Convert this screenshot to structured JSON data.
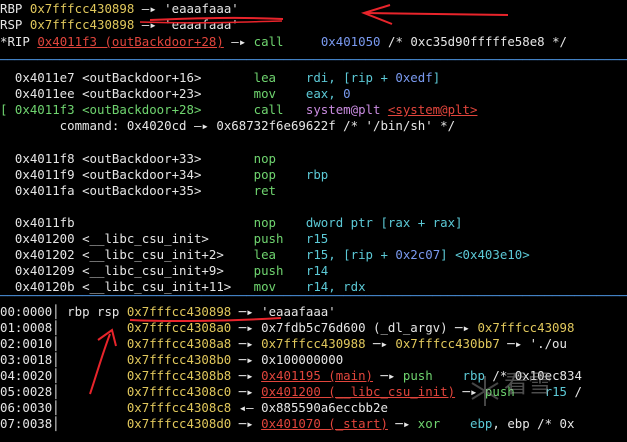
{
  "registers": {
    "rbp": {
      "name": "RBP",
      "addr": "0x7fffcc430898",
      "arrow": "—▸",
      "value": "'eaaafaaa'"
    },
    "rsp": {
      "name": "RSP",
      "addr": "0x7fffcc430898",
      "arrow": "—▸",
      "value": "'eaaafaaa'"
    },
    "rip": {
      "name": "*RIP",
      "addr": "0x4011f3 (outBackdoor+28)",
      "arrow": "—▸",
      "op": "call",
      "arg": "0x401050",
      "comment": "/* 0xc35d90fffffe58e8 */"
    }
  },
  "separator": "──────────────────────────────────────────────────────────────────────────────────────────────",
  "disasm": [
    {
      "addr": "0x4011e7",
      "sym": "<outBackdoor+16>",
      "op": "lea",
      "a": "rdi, [rip + ",
      "b": "0xedf",
      "c": "]"
    },
    {
      "addr": "0x4011ee",
      "sym": "<outBackdoor+23>",
      "op": "mov",
      "a": "eax, ",
      "b": "0",
      "c": ""
    },
    {
      "addr": "0x4011f3",
      "sym": "<outBackdoor+28>",
      "op": "call",
      "a": "system@plt",
      "b": "<system@plt>",
      "c": ""
    },
    {
      "addr": "0x4011f8",
      "sym": "<outBackdoor+33>",
      "op": "nop",
      "a": "",
      "b": "",
      "c": ""
    },
    {
      "addr": "0x4011f9",
      "sym": "<outBackdoor+34>",
      "op": "pop",
      "a": "rbp",
      "b": "",
      "c": ""
    },
    {
      "addr": "0x4011fa",
      "sym": "<outBackdoor+35>",
      "op": "ret",
      "a": "",
      "b": "",
      "c": ""
    },
    {
      "addr": "0x4011fb",
      "sym": "",
      "op": "nop",
      "a": "dword ptr [rax + rax]",
      "b": "",
      "c": ""
    },
    {
      "addr": "0x401200",
      "sym": "<__libc_csu_init>",
      "op": "push",
      "a": "r15",
      "b": "",
      "c": ""
    },
    {
      "addr": "0x401202",
      "sym": "<__libc_csu_init+2>",
      "op": "lea",
      "a": "r15, [rip + ",
      "b": "0x2c07",
      "c": "] <0x403e10>"
    },
    {
      "addr": "0x401209",
      "sym": "<__libc_csu_init+9>",
      "op": "push",
      "a": "r14",
      "b": "",
      "c": ""
    },
    {
      "addr": "0x40120b",
      "sym": "<__libc_csu_init+11>",
      "op": "mov",
      "a": "r14, rdx",
      "b": "",
      "c": ""
    }
  ],
  "current_marker": "[",
  "command": {
    "label": "command:",
    "addr": "0x4020cd",
    "arrow": "—▸",
    "value": "0x68732f6e69622f /* '/bin/sh' */"
  },
  "stack": [
    {
      "idx": "00:0000",
      "regs": "rbp rsp",
      "addr": "0x7fffcc430898",
      "tail": [
        {
          "t": "w",
          "v": " ─▸ 'eaaafaaa'"
        }
      ]
    },
    {
      "idx": "01:0008",
      "regs": "",
      "addr": "0x7fffcc4308a0",
      "tail": [
        {
          "t": "w",
          "v": " ─▸ 0x7fdb5c76d600 (_dl_argv) ─▸ "
        },
        {
          "t": "y",
          "v": "0x7fffcc43098"
        }
      ]
    },
    {
      "idx": "02:0010",
      "regs": "",
      "addr": "0x7fffcc4308a8",
      "tail": [
        {
          "t": "w",
          "v": " ─▸ "
        },
        {
          "t": "y",
          "v": "0x7fffcc430988"
        },
        {
          "t": "w",
          "v": " ─▸ "
        },
        {
          "t": "y",
          "v": "0x7fffcc430bb7"
        },
        {
          "t": "w",
          "v": " ─▸ './ou"
        }
      ]
    },
    {
      "idx": "03:0018",
      "regs": "",
      "addr": "0x7fffcc4308b0",
      "tail": [
        {
          "t": "w",
          "v": " ─▸ 0x100000000"
        }
      ]
    },
    {
      "idx": "04:0020",
      "regs": "",
      "addr": "0x7fffcc4308b8",
      "tail": [
        {
          "t": "w",
          "v": " ─▸ "
        },
        {
          "t": "ru",
          "v": "0x401195 (main)"
        },
        {
          "t": "w",
          "v": " ─▸ "
        },
        {
          "t": "g",
          "v": "push"
        },
        {
          "t": "w",
          "v": "    "
        },
        {
          "t": "c",
          "v": "rbp"
        },
        {
          "t": "w",
          "v": " /* 0x10ec834"
        }
      ]
    },
    {
      "idx": "05:0028",
      "regs": "",
      "addr": "0x7fffcc4308c0",
      "tail": [
        {
          "t": "w",
          "v": " ─▸ "
        },
        {
          "t": "ru",
          "v": "0x401200 (__libc_csu_init)"
        },
        {
          "t": "w",
          "v": " ─▸ "
        },
        {
          "t": "g",
          "v": "push"
        },
        {
          "t": "w",
          "v": "    "
        },
        {
          "t": "c",
          "v": "r15"
        },
        {
          "t": "w",
          "v": " /"
        }
      ]
    },
    {
      "idx": "06:0030",
      "regs": "",
      "addr": "0x7fffcc4308c8",
      "tail": [
        {
          "t": "w",
          "v": " ◂— 0x885590a6eccbb2e"
        }
      ]
    },
    {
      "idx": "07:0038",
      "regs": "",
      "addr": "0x7fffcc4308d0",
      "tail": [
        {
          "t": "w",
          "v": " ─▸ "
        },
        {
          "t": "ru",
          "v": "0x401070 (_start)"
        },
        {
          "t": "w",
          "v": " ─▸ "
        },
        {
          "t": "g",
          "v": "xor"
        },
        {
          "t": "w",
          "v": "    "
        },
        {
          "t": "c",
          "v": "ebp"
        },
        {
          "t": "w",
          "v": ", ebp /* 0x"
        }
      ]
    }
  ],
  "watermark": "看雪",
  "colors": {
    "bg": "#000000",
    "yellow": "#e1c85c",
    "red": "#e2453c",
    "green": "#6fd46f",
    "cyan": "#5cc9d6",
    "blue": "#7a9af0",
    "annotation": "#e8242b"
  }
}
